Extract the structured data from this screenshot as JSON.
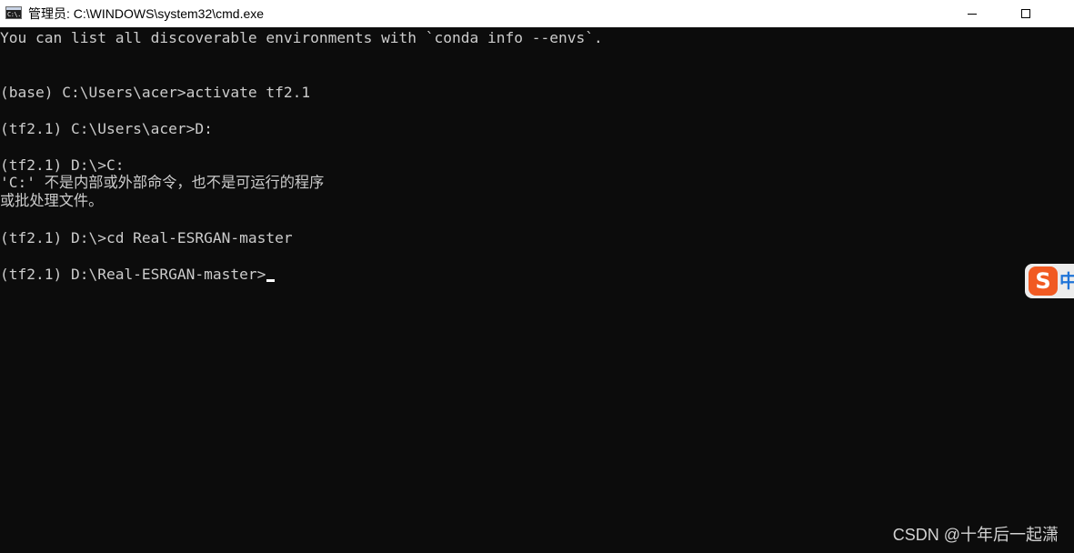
{
  "window": {
    "title": "管理员: C:\\WINDOWS\\system32\\cmd.exe",
    "app_icon": "cmd-icon",
    "app_icon_text": "C:\\.",
    "controls": {
      "minimize_icon": "minimize-icon",
      "maximize_icon": "maximize-icon"
    }
  },
  "console": {
    "lines": [
      "You can list all discoverable environments with `conda info --envs`.",
      "",
      "",
      "(base) C:\\Users\\acer>activate tf2.1",
      "",
      "(tf2.1) C:\\Users\\acer>D:",
      "",
      "(tf2.1) D:\\>C:",
      "'C:' 不是内部或外部命令，也不是可运行的程序",
      "或批处理文件。",
      "",
      "(tf2.1) D:\\>cd Real-ESRGAN-master",
      "",
      "(tf2.1) D:\\Real-ESRGAN-master>"
    ],
    "colors": {
      "background": "#0c0c0c",
      "foreground": "#cccccc",
      "cursor": "#ffffff"
    }
  },
  "ime_indicator": {
    "icon": "sogou-ime-icon",
    "logo_text": "S",
    "mode_text": "中"
  },
  "watermark": {
    "text": "CSDN @十年后一起潇"
  }
}
